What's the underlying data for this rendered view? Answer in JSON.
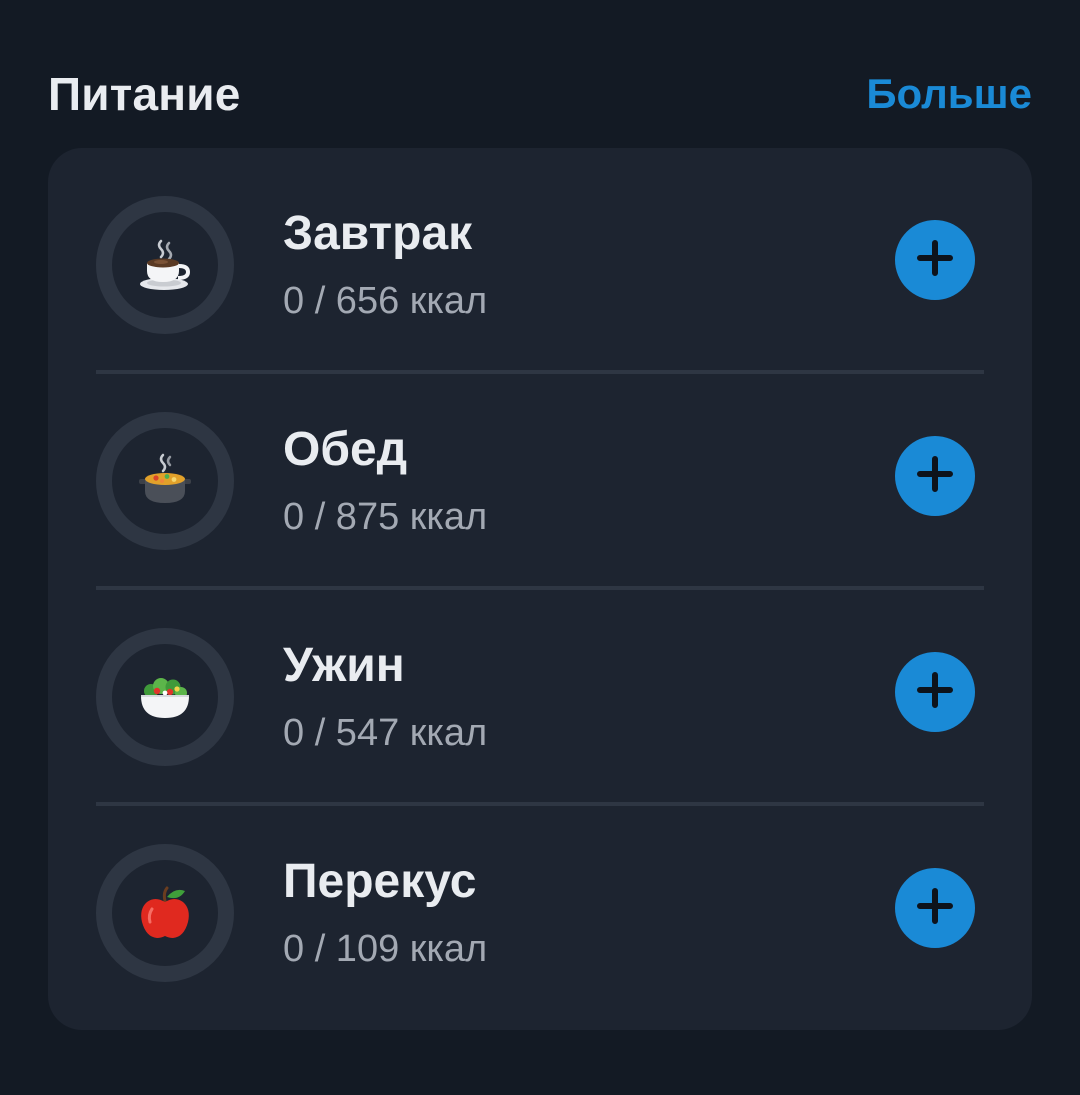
{
  "section": {
    "title": "Питание",
    "more_label": "Больше"
  },
  "meals": [
    {
      "name": "Завтрак",
      "kcal": "0 / 656 ккал",
      "icon": "coffee-cup-icon"
    },
    {
      "name": "Обед",
      "kcal": "0 / 875 ккал",
      "icon": "pot-of-food-icon"
    },
    {
      "name": "Ужин",
      "kcal": "0 / 547 ккал",
      "icon": "salad-bowl-icon"
    },
    {
      "name": "Перекус",
      "kcal": "0 / 109 ккал",
      "icon": "apple-icon"
    }
  ],
  "colors": {
    "background": "#131a24",
    "card": "#1d2430",
    "accent": "#1a8ad6",
    "ring": "#2e3643"
  }
}
